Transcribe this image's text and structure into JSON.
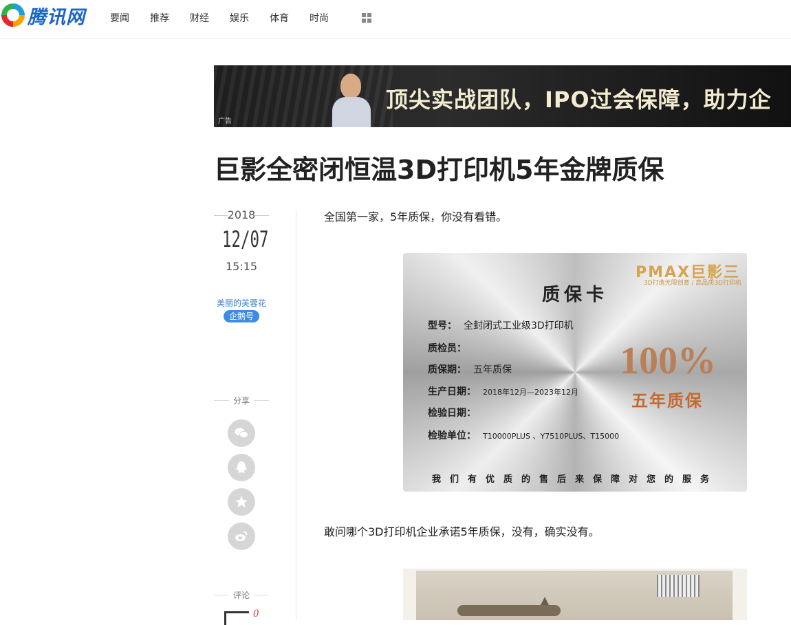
{
  "header": {
    "logo_text": "腾讯网",
    "nav": [
      "要闻",
      "推荐",
      "财经",
      "娱乐",
      "体育",
      "时尚"
    ]
  },
  "banner": {
    "ad_label": "广告",
    "slogan": "顶尖实战团队，IPO过会保障，助力企"
  },
  "article": {
    "title": "巨影全密闭恒温3D打印机5年金牌质保",
    "year": "2018",
    "monthday": "12/07",
    "time": "15:15",
    "author": "美丽的芙蓉花",
    "badge": "企鹅号",
    "share_label": "分享",
    "comment_label": "评论",
    "comment_count": "0",
    "para1": "全国第一家，5年质保，你没有看错。",
    "para2": "敢问哪个3D打印机企业承诺5年质保，没有，确实没有。"
  },
  "card": {
    "brand": "PMAX巨影三",
    "brand_sub": "3D打造无限创意 / 高品质3D打印机",
    "title": "质保卡",
    "rows": [
      {
        "label": "型号：",
        "value": "全封闭式工业级3D打印机"
      },
      {
        "label": "质检员：",
        "value": ""
      },
      {
        "label": "质保期：",
        "value": "五年质保"
      },
      {
        "label": "生产日期：",
        "value": "2018年12月—2023年12月"
      },
      {
        "label": "检验日期：",
        "value": ""
      },
      {
        "label": "检验单位：",
        "value": "T10000PLUS 、Y7510PLUS、T15000"
      }
    ],
    "percent": "100%",
    "years_text": "五年质保",
    "footer": "我们有优质的售后来保障对您的服务"
  }
}
